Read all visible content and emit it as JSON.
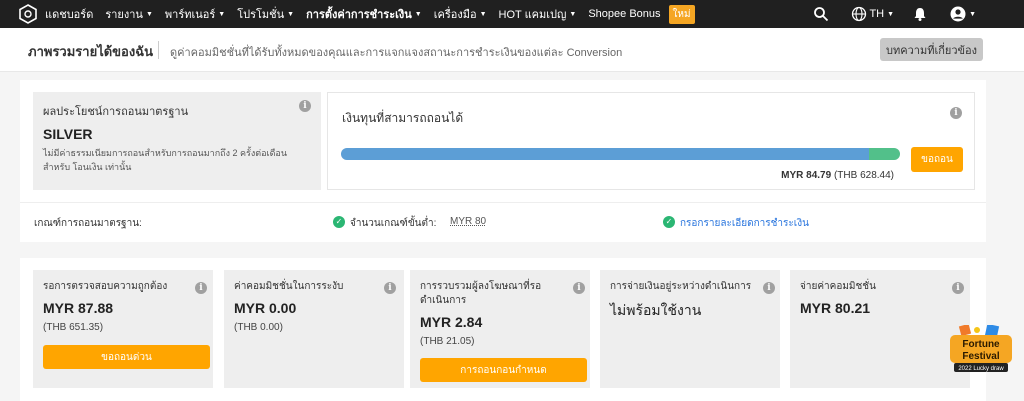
{
  "nav": {
    "items": [
      {
        "label": "แดชบอร์ด",
        "caret": false,
        "active": false
      },
      {
        "label": "รายงาน",
        "caret": true,
        "active": false
      },
      {
        "label": "พาร์ทเนอร์",
        "caret": true,
        "active": false
      },
      {
        "label": "โปรโมชั่น",
        "caret": true,
        "active": false
      },
      {
        "label": "การตั้งค่าการชำระเงิน",
        "caret": true,
        "active": true
      },
      {
        "label": "เครื่องมือ",
        "caret": true,
        "active": false
      },
      {
        "label": "HOT แคมเปญ",
        "caret": true,
        "active": false
      },
      {
        "label": "Shopee Bonus",
        "caret": false,
        "active": false
      }
    ],
    "new_badge": "ใหม่",
    "language": "TH"
  },
  "header": {
    "title": "ภาพรวมรายได้ของฉัน",
    "description": "ดูค่าคอมมิชชั่นที่ได้รับทั้งหมดของคุณและการแจกแจงสถานะการชำระเงินของแต่ละ Conversion",
    "article_button": "บทความที่เกี่ยวข้อง"
  },
  "withdrawal": {
    "tier_label": "ผลประโยชน์การถอนมาตรฐาน",
    "tier_name": "SILVER",
    "tier_description": "ไม่มีค่าธรรมเนียมการถอนสำหรับการถอนมากถึง 2 ครั้งต่อเดือนสำหรับ โอนเงิน เท่านั้น",
    "balance_label": "เงินทุนที่สามารถถอนได้",
    "progress_blue_fraction": 0.945,
    "progress_green_fraction": 0.055,
    "withdraw_button": "ขอถอน",
    "amount_main": "MYR 84.79",
    "amount_sub": "(THB 628.44)"
  },
  "criteria": {
    "label": "เกณฑ์การถอนมาตรฐาน:",
    "min_label": "จำนวนเกณฑ์ขั้นต่ำ:",
    "min_value": "MYR 80",
    "details_link": "กรอกรายละเอียดการชำระเงิน"
  },
  "stats": [
    {
      "label": "รอการตรวจสอบความถูกต้อง",
      "value": "MYR 87.88",
      "sub": "(THB 651.35)",
      "button": "ขอถอนด่วน"
    },
    {
      "label": "ค่าคอมมิชชั่นในการระงับ",
      "value": "MYR 0.00",
      "sub": "(THB 0.00)",
      "button": ""
    },
    {
      "label": "การรวบรวมผู้ลงโฆษณาที่รอดำเนินการ",
      "value": "MYR 2.84",
      "sub": "(THB 21.05)",
      "button": "การถอนกอนกำหนด"
    },
    {
      "label": "การจ่ายเงินอยู่ระหว่างดำเนินการ",
      "value": "ไม่พร้อมใช้งาน",
      "sub": "",
      "button": ""
    },
    {
      "label": "จ่ายค่าคอมมิชชั่น",
      "value": "MYR 80.21",
      "sub": "",
      "button": ""
    }
  ],
  "colors": {
    "accent": "#ffa500",
    "nav_bg": "#202020",
    "bar_blue": "#5c9ed6",
    "bar_green": "#52c08a",
    "link": "#2673dd",
    "check": "#2bb673"
  },
  "festival": {
    "line1": "Fortune",
    "line2": "Festival",
    "line3": "2022 Lucky draw"
  }
}
